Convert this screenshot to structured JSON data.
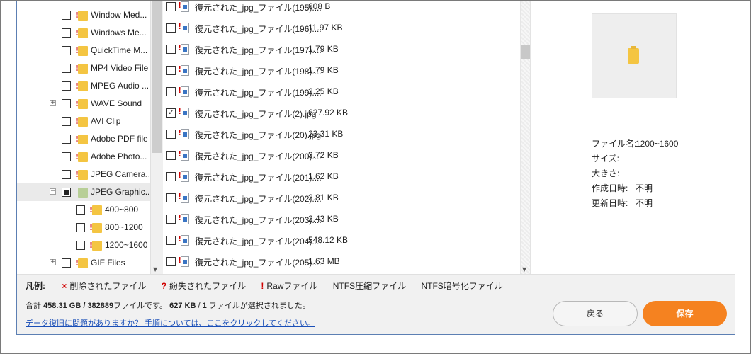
{
  "tree": {
    "items": [
      {
        "label": "Window Med...",
        "marked": true,
        "level": 0,
        "expander": false
      },
      {
        "label": "Windows Me...",
        "marked": true,
        "level": 0,
        "expander": false
      },
      {
        "label": "QuickTime M...",
        "marked": true,
        "level": 0,
        "expander": false
      },
      {
        "label": "MP4 Video File",
        "marked": true,
        "level": 0,
        "expander": false
      },
      {
        "label": "MPEG Audio ...",
        "marked": true,
        "level": 0,
        "expander": false
      },
      {
        "label": "WAVE Sound",
        "marked": true,
        "level": 0,
        "expander": "plus"
      },
      {
        "label": "AVI Clip",
        "marked": true,
        "level": 0,
        "expander": false
      },
      {
        "label": "Adobe PDF file",
        "marked": true,
        "level": 0,
        "expander": false
      },
      {
        "label": "Adobe Photo...",
        "marked": true,
        "level": 0,
        "expander": false
      },
      {
        "label": "JPEG Camera...",
        "marked": true,
        "level": 0,
        "expander": false
      },
      {
        "label": "JPEG Graphic...",
        "marked": false,
        "level": 0,
        "expander": "minus",
        "partial": true,
        "green": true,
        "selected": true
      },
      {
        "label": "400~800",
        "marked": true,
        "level": 1,
        "expander": false
      },
      {
        "label": "800~1200",
        "marked": true,
        "level": 1,
        "expander": false
      },
      {
        "label": "1200~1600",
        "marked": true,
        "level": 1,
        "expander": false
      },
      {
        "label": "GIF Files",
        "marked": true,
        "level": 0,
        "expander": "plus"
      }
    ]
  },
  "files": [
    {
      "name": "復元された_jpg_ファイル(195)....",
      "size": "608 B",
      "checked": false
    },
    {
      "name": "復元された_jpg_ファイル(196)....",
      "size": "11.97 KB",
      "checked": false
    },
    {
      "name": "復元された_jpg_ファイル(197)....",
      "size": "1.79 KB",
      "checked": false
    },
    {
      "name": "復元された_jpg_ファイル(198)....",
      "size": "1.79 KB",
      "checked": false
    },
    {
      "name": "復元された_jpg_ファイル(199)....",
      "size": "2.25 KB",
      "checked": false
    },
    {
      "name": "復元された_jpg_ファイル(2).jpg",
      "size": "627.92 KB",
      "checked": true
    },
    {
      "name": "復元された_jpg_ファイル(20).jpg",
      "size": "23.31 KB",
      "checked": false
    },
    {
      "name": "復元された_jpg_ファイル(200)....",
      "size": "3.72 KB",
      "checked": false
    },
    {
      "name": "復元された_jpg_ファイル(201)....",
      "size": "1.62 KB",
      "checked": false
    },
    {
      "name": "復元された_jpg_ファイル(202)....",
      "size": "2.81 KB",
      "checked": false
    },
    {
      "name": "復元された_jpg_ファイル(203)....",
      "size": "2.43 KB",
      "checked": false
    },
    {
      "name": "復元された_jpg_ファイル(204)....",
      "size": "548.12 KB",
      "checked": false
    },
    {
      "name": "復元された_jpg_ファイル(205)....",
      "size": "1.63 MB",
      "checked": false
    }
  ],
  "preview": {
    "icon": "folder-icon",
    "info": [
      {
        "key": "ファイル名:",
        "value": "1200~1600"
      },
      {
        "key": "サイズ:",
        "value": ""
      },
      {
        "key": "大きさ:",
        "value": ""
      },
      {
        "key": "作成日時:",
        "value": "不明"
      },
      {
        "key": "更新日時:",
        "value": "不明"
      }
    ]
  },
  "legend": {
    "title": "凡例:",
    "deleted_mark": "×",
    "deleted": "削除されたファイル",
    "lost_mark": "?",
    "lost": "紛失されたファイル",
    "raw_mark": "!",
    "raw": "Rawファイル",
    "ntfs_compressed": "NTFS圧縮ファイル",
    "ntfs_encrypted": "NTFS暗号化ファイル"
  },
  "summary": {
    "prefix": "合計 ",
    "total_size": "458.31 GB",
    "sep": " / ",
    "total_count": "382889",
    "mid": "ファイルです。 ",
    "sel_size": "627 KB",
    "sel_sep": " / ",
    "sel_count": "1",
    "suffix": " ファイルが選択されました。"
  },
  "help_link": "データ復旧に問題がありますか？ 手順については、ここをクリックしてください。",
  "buttons": {
    "back": "戻る",
    "save": "保存"
  },
  "colors": {
    "accent": "#f58220",
    "link": "#1a4fb8",
    "mark": "#d00000"
  }
}
